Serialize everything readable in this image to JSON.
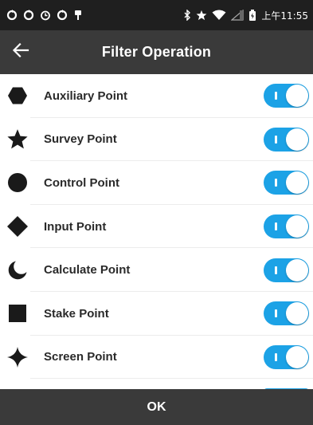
{
  "status_bar": {
    "left_icons": [
      "sync-icon",
      "sync-icon",
      "alarm-icon",
      "sync-icon",
      "usb-icon"
    ],
    "right_icons": [
      "bluetooth-icon",
      "star-icon",
      "wifi-icon",
      "signal-icon",
      "battery-icon"
    ],
    "time": "上午11:55"
  },
  "header": {
    "title": "Filter Operation",
    "back_icon": "arrow-left-icon"
  },
  "filters": [
    {
      "label": "Auxiliary Point",
      "icon": "hexagon-icon",
      "enabled": true
    },
    {
      "label": "Survey Point",
      "icon": "star-icon",
      "enabled": true
    },
    {
      "label": "Control Point",
      "icon": "circle-icon",
      "enabled": true
    },
    {
      "label": "Input Point",
      "icon": "diamond-icon",
      "enabled": true
    },
    {
      "label": "Calculate Point",
      "icon": "crescent-moon-icon",
      "enabled": true
    },
    {
      "label": "Stake Point",
      "icon": "square-icon",
      "enabled": true
    },
    {
      "label": "Screen Point",
      "icon": "four-point-star-icon",
      "enabled": true
    }
  ],
  "footer": {
    "ok_label": "OK"
  },
  "colors": {
    "status_bar_bg": "#1f1f1f",
    "header_bg": "#3a3a3a",
    "footer_bg": "#3a3a3a",
    "toggle_on": "#1ca2e6",
    "label_text": "#2a2a2a",
    "icon_fill": "#1a1a1a"
  }
}
